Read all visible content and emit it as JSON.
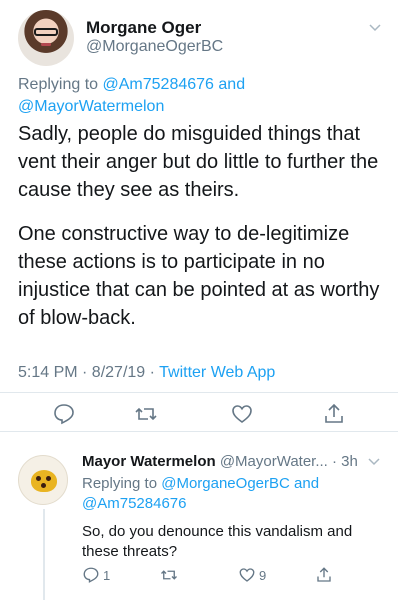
{
  "main_tweet": {
    "author_name": "Morgane Oger",
    "author_handle": "@MorganeOgerBC",
    "replying_prefix": "Replying to",
    "replying_user1": "@Am75284676",
    "replying_and": "and",
    "replying_user2": "@MayorWatermelon",
    "paragraph1": "Sadly, people do misguided things that vent their anger but do little to further the cause they see as theirs.",
    "paragraph2": "One constructive way to de-legitimize these actions is to participate in no injustice that can be pointed at as worthy of blow-back.",
    "timestamp": "5:14 PM · 8/27/19 · ",
    "source": "Twitter Web App"
  },
  "reply_tweet": {
    "author_name": "Mayor Watermelon",
    "author_handle": "@MayorWater...",
    "time": " · 3h",
    "replying_prefix": "Replying to",
    "replying_user1": "@MorganeOgerBC",
    "replying_and": "and",
    "replying_user2": "@Am75284676",
    "text": "So, do you denounce this vandalism and these threats?",
    "reply_count": "1",
    "like_count": "9"
  },
  "colors": {
    "accent": "#1da1f2",
    "secondary_text": "#657786",
    "divider": "#e1e8ed"
  },
  "icons": [
    "chevron-down-icon",
    "reply-icon",
    "retweet-icon",
    "like-icon",
    "share-icon"
  ]
}
